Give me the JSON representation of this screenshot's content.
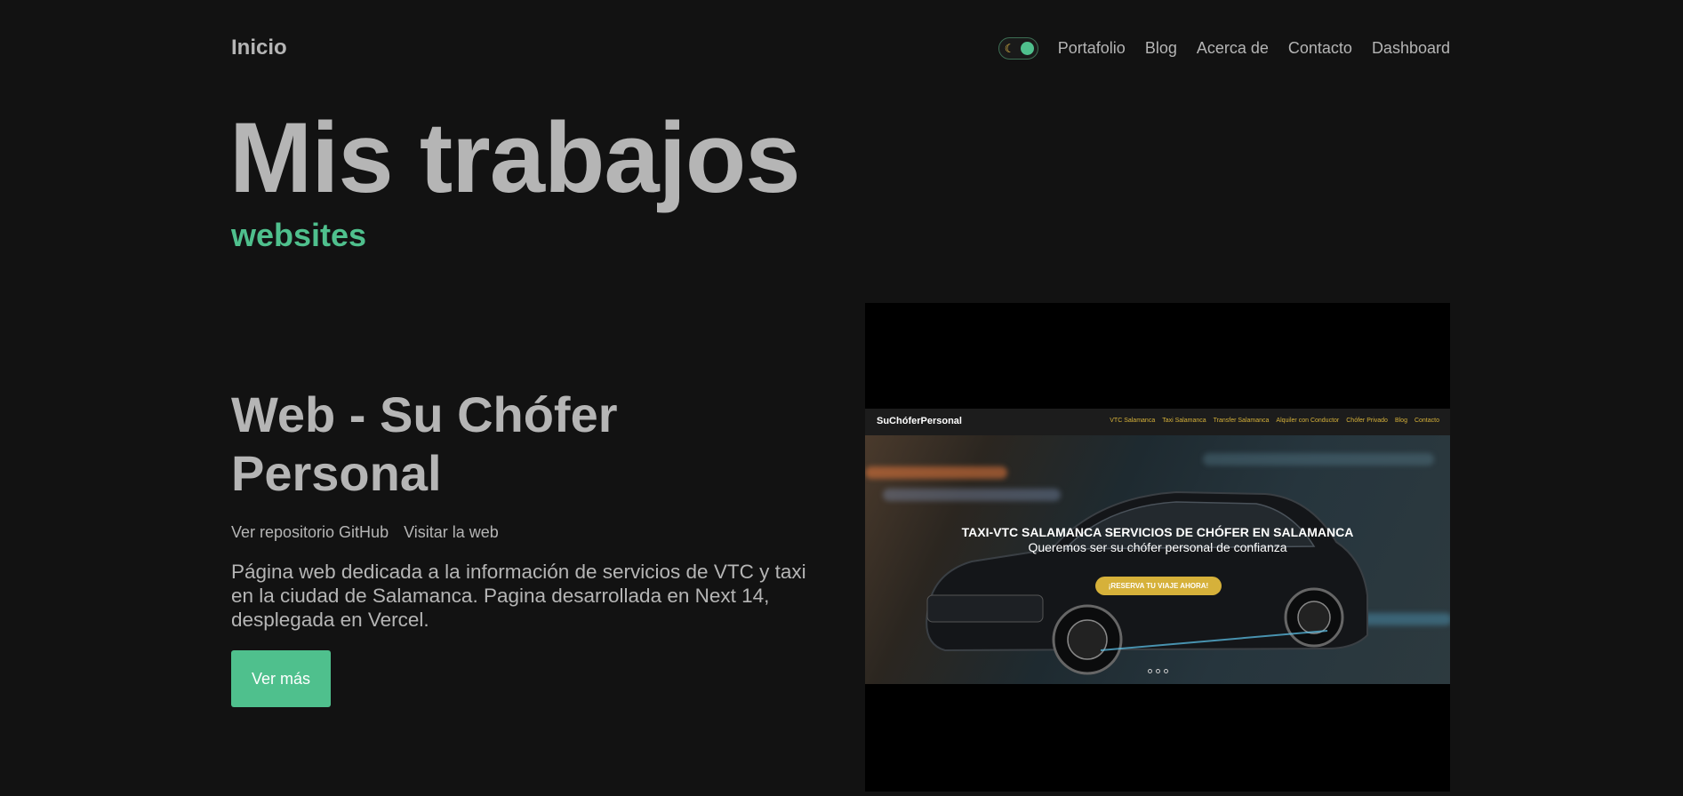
{
  "header": {
    "brand": "Inicio",
    "nav": [
      "Portafolio",
      "Blog",
      "Acerca de",
      "Contacto",
      "Dashboard"
    ],
    "theme_toggle_icon": "moon-icon"
  },
  "hero": {
    "title": "Mis trabajos",
    "subtitle": "websites"
  },
  "project": {
    "title": "Web - Su Chófer Personal",
    "link_repo": "Ver repositorio GitHub",
    "link_site": "Visitar la web",
    "description": "Página web dedicada a la información de servicios de VTC y taxi en la ciudad de Salamanca. Pagina desarrollada en Next 14, desplegada en Vercel.",
    "button": "Ver más"
  },
  "preview": {
    "logo": "SuChóferPersonal",
    "nav": [
      "VTC Salamanca",
      "Taxi Salamanca",
      "Transfer Salamanca",
      "Alquiler con Conductor",
      "Chófer Privado",
      "Blog",
      "Contacto"
    ],
    "headline": "TAXI-VTC SALAMANCA SERVICIOS DE CHÓFER EN SALAMANCA",
    "tagline": "Queremos ser su chófer personal de confianza",
    "cta": "¡RESERVA TU VIAJE AHORA!"
  },
  "colors": {
    "background": "#121212",
    "text": "#b5b5b5",
    "accent": "#4fc08d",
    "preview_accent": "#d6b13a"
  }
}
